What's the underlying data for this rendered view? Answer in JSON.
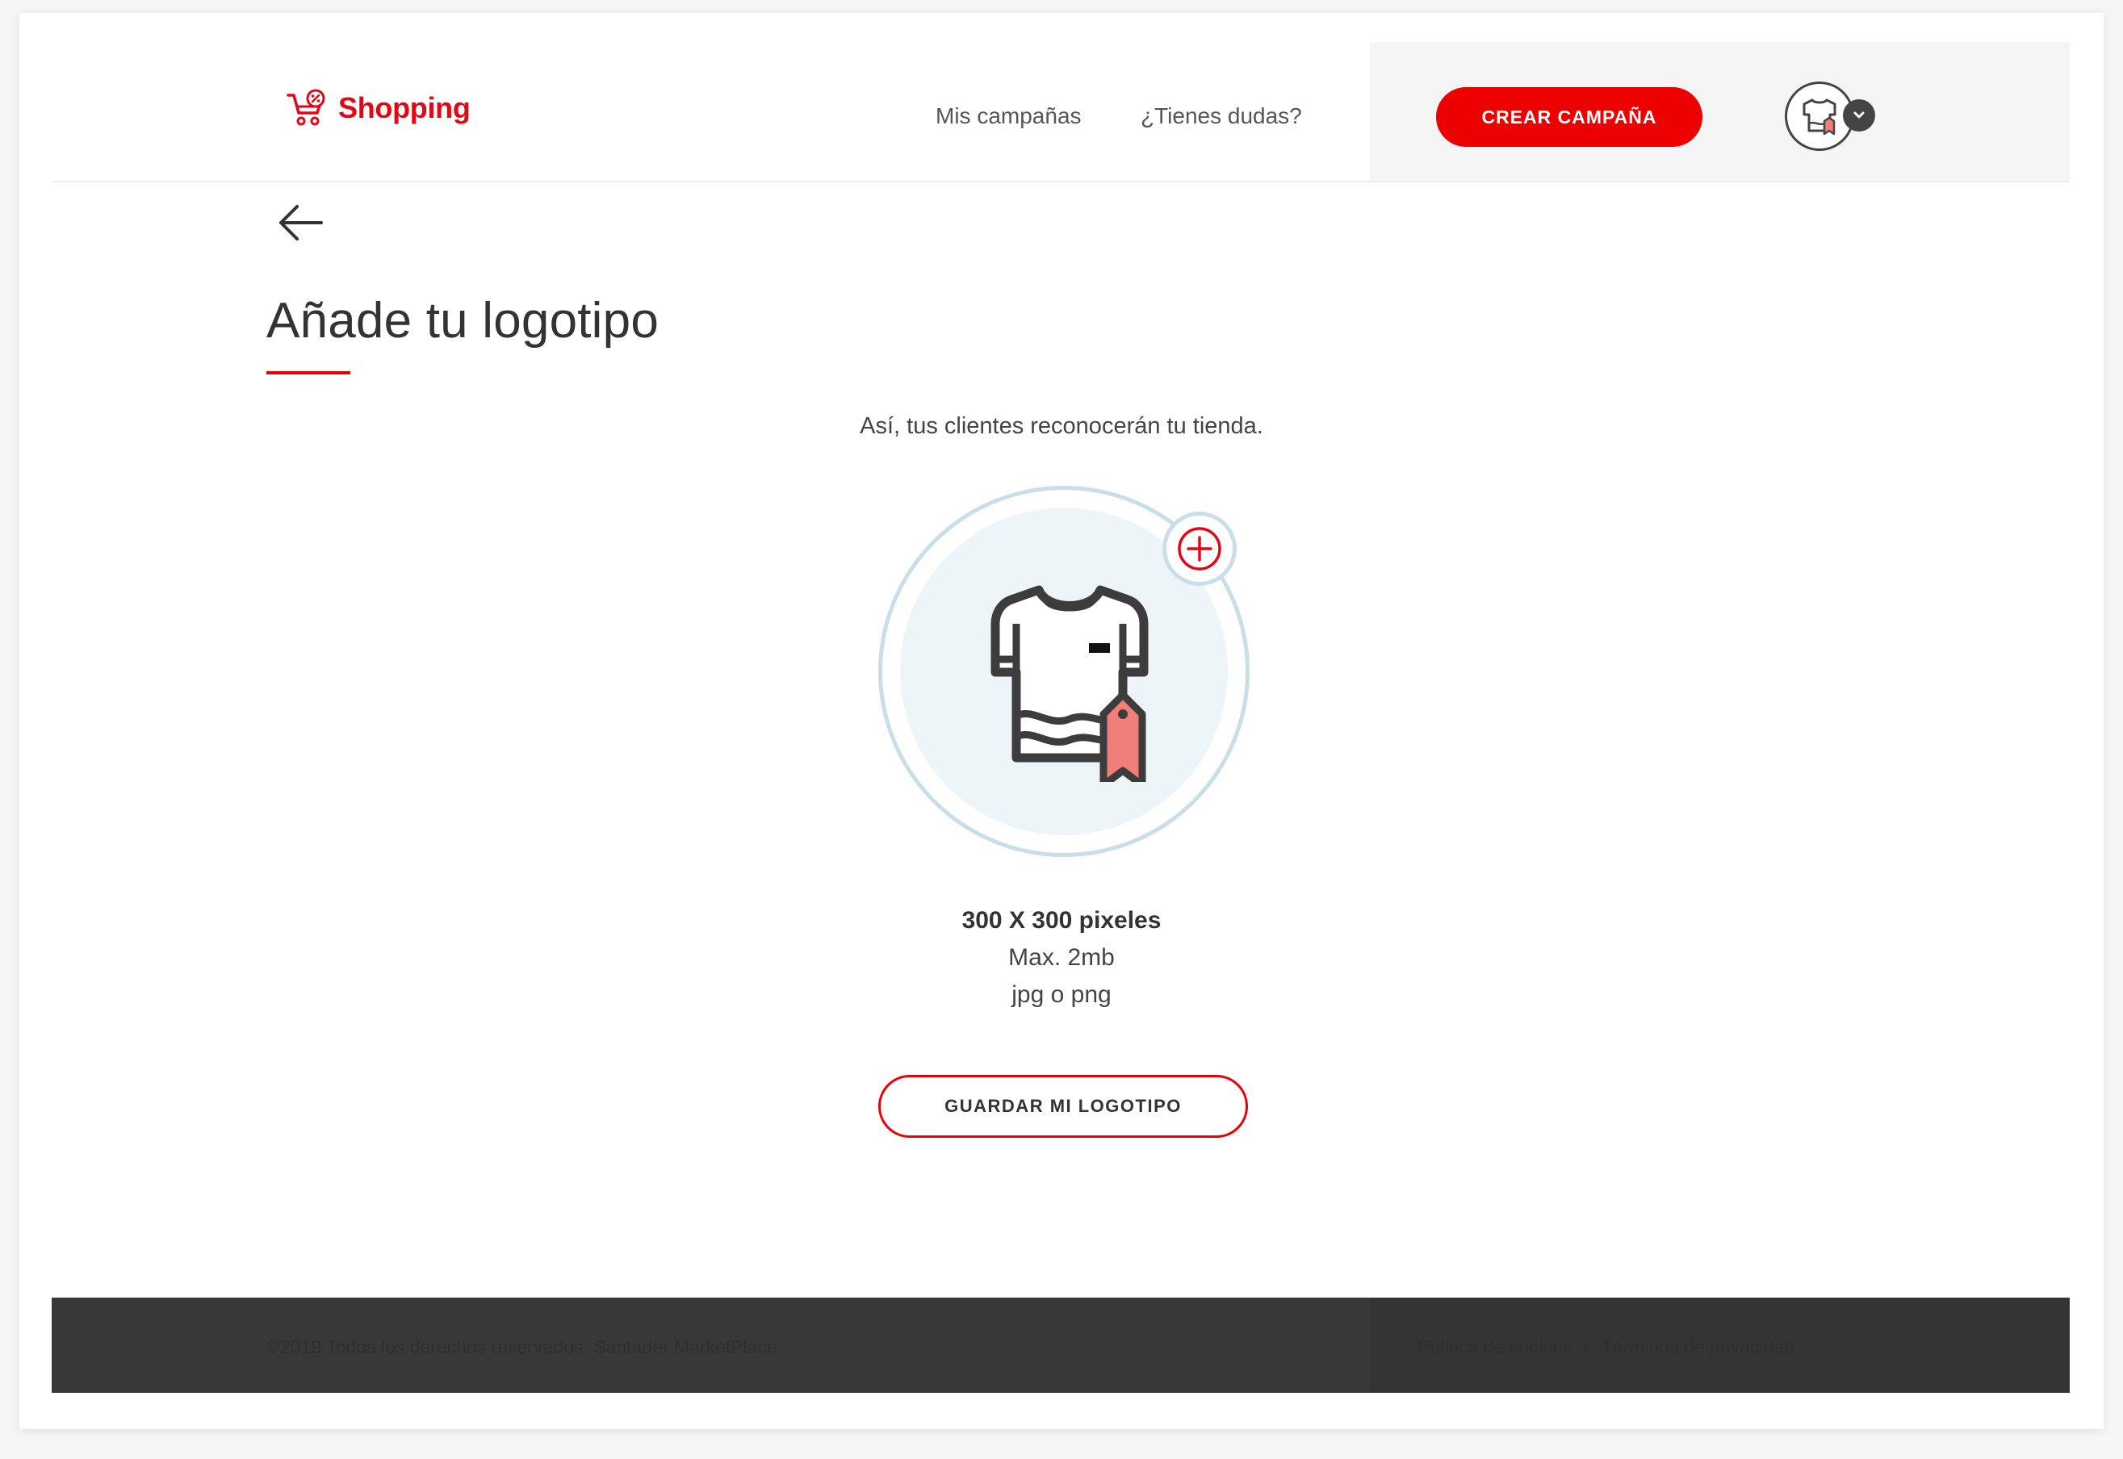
{
  "header": {
    "brand": "Shopping",
    "nav": [
      {
        "label": "Mis campañas"
      },
      {
        "label": "¿Tienes dudas?"
      }
    ],
    "cta_label": "CREAR CAMPAÑA"
  },
  "page": {
    "title": "Añade tu logotipo",
    "subtitle": "Así, tus clientes reconocerán tu tienda."
  },
  "uploader": {
    "specs": [
      "300 X 300 pixeles",
      "Max. 2mb",
      "jpg o png"
    ],
    "save_label": "GUARDAR MI LOGOTIPO"
  },
  "footer": {
    "copyright": "©2019 Todos los derechos reservados. Santader MarketPlace",
    "links": [
      "Política de cookies",
      "Términos de privacidad"
    ],
    "separator": "•"
  },
  "colors": {
    "brand_red": "#ec0000",
    "ring": "#c8dfe8",
    "circle_fill": "#eef5f8",
    "tag_coral": "#f07f79",
    "footer_bg": "#383838"
  },
  "icons": {
    "brand": "shopping-cart-icon",
    "back": "arrow-left-icon",
    "avatar": "tshirt-icon",
    "avatar_menu": "chevron-down-icon",
    "upload": "tshirt-tag-icon",
    "add": "plus-circle-icon"
  }
}
